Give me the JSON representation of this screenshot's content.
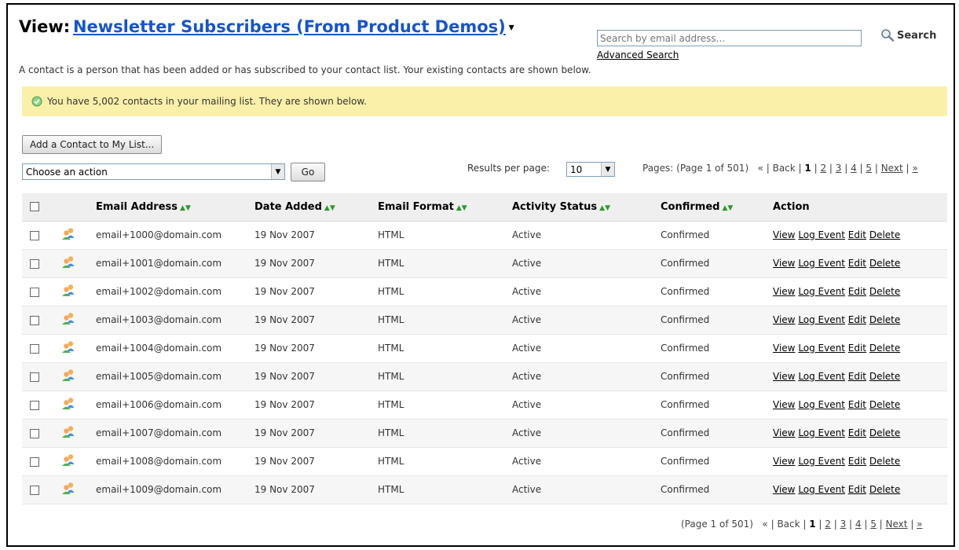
{
  "header": {
    "view_label": "View:",
    "view_name": "Newsletter Subscribers (From Product Demos)",
    "intro": "A contact is a person that has been added or has subscribed to your contact list. Your existing contacts are shown below."
  },
  "search": {
    "placeholder": "Search by email address...",
    "button_label": "Search",
    "advanced_link": "Advanced Search"
  },
  "notice": {
    "text": "You have 5,002 contacts in your mailing list. They are shown below.",
    "color": "#fbf0a9"
  },
  "toolbar": {
    "add_button": "Add a Contact to My List...",
    "action_select_value": "Choose an action",
    "go_button": "Go",
    "results_label": "Results per page:",
    "results_value": "10"
  },
  "pager": {
    "pages_label": "Pages: (Page 1 of 501)",
    "bottom_label": "(Page 1 of 501)",
    "first": "«",
    "back": "Back",
    "current": "1",
    "pages": [
      "2",
      "3",
      "4",
      "5"
    ],
    "next": "Next",
    "last": "»"
  },
  "table": {
    "columns": [
      "Email Address",
      "Date Added",
      "Email Format",
      "Activity Status",
      "Confirmed",
      "Action"
    ],
    "action_labels": [
      "View",
      "Log Event",
      "Edit",
      "Delete"
    ],
    "rows": [
      {
        "email": "email+1000@domain.com",
        "date": "19 Nov 2007",
        "format": "HTML",
        "status": "Active",
        "confirmed": "Confirmed"
      },
      {
        "email": "email+1001@domain.com",
        "date": "19 Nov 2007",
        "format": "HTML",
        "status": "Active",
        "confirmed": "Confirmed"
      },
      {
        "email": "email+1002@domain.com",
        "date": "19 Nov 2007",
        "format": "HTML",
        "status": "Active",
        "confirmed": "Confirmed"
      },
      {
        "email": "email+1003@domain.com",
        "date": "19 Nov 2007",
        "format": "HTML",
        "status": "Active",
        "confirmed": "Confirmed"
      },
      {
        "email": "email+1004@domain.com",
        "date": "19 Nov 2007",
        "format": "HTML",
        "status": "Active",
        "confirmed": "Confirmed"
      },
      {
        "email": "email+1005@domain.com",
        "date": "19 Nov 2007",
        "format": "HTML",
        "status": "Active",
        "confirmed": "Confirmed"
      },
      {
        "email": "email+1006@domain.com",
        "date": "19 Nov 2007",
        "format": "HTML",
        "status": "Active",
        "confirmed": "Confirmed"
      },
      {
        "email": "email+1007@domain.com",
        "date": "19 Nov 2007",
        "format": "HTML",
        "status": "Active",
        "confirmed": "Confirmed"
      },
      {
        "email": "email+1008@domain.com",
        "date": "19 Nov 2007",
        "format": "HTML",
        "status": "Active",
        "confirmed": "Confirmed"
      },
      {
        "email": "email+1009@domain.com",
        "date": "19 Nov 2007",
        "format": "HTML",
        "status": "Active",
        "confirmed": "Confirmed"
      }
    ]
  },
  "icons": {
    "search": "magnifier-icon",
    "notice": "check-circle-icon",
    "contact": "contact-person-icon",
    "sort": "sort-arrows-icon",
    "dropdown": "dropdown-arrow-icon",
    "view_menu": "caret-down-icon"
  },
  "colors": {
    "link": "#1a55c0",
    "banner": "#fbf0a9",
    "header_bg": "#efefef",
    "sort_arrow": "#2a9a2a"
  }
}
